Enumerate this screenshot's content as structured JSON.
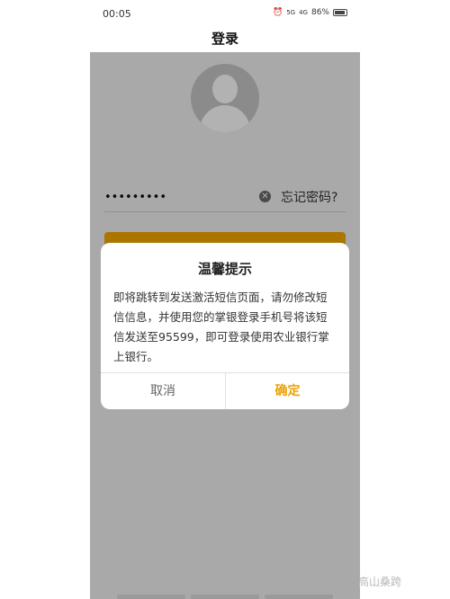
{
  "status_bar": {
    "time": "00:05",
    "network_1": "5G",
    "network_2": "4G",
    "battery": "86%"
  },
  "header": {
    "title": "登录"
  },
  "login_form": {
    "password_value": "•••••••••",
    "forgot_label": "忘记密码?"
  },
  "dialog": {
    "title": "温馨提示",
    "message": "即将跳转到发送激活短信页面，请勿修改短信信息，并使用您的掌银登录手机号将该短信发送至95599，即可登录使用农业银行掌上银行。",
    "cancel_label": "取消",
    "confirm_label": "确定"
  },
  "watermark": "高山桑跨",
  "colors": {
    "accent": "#f5a800",
    "confirm_text": "#f0a000",
    "overlay": "rgba(0,0,0,0.30)"
  }
}
